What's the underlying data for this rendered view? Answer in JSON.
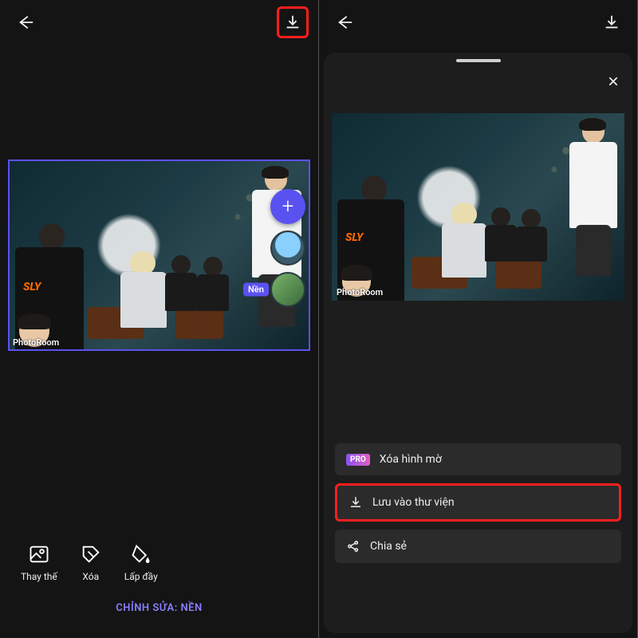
{
  "left": {
    "watermark": "PhotoRoom",
    "layer_tag": "Nền",
    "toolbar": {
      "replace": "Thay thế",
      "delete": "Xóa",
      "fill": "Lấp đầy"
    },
    "editing_label": "CHỈNH SỬA: NỀN"
  },
  "right": {
    "watermark": "PhotoRoom",
    "menu": {
      "pro_badge": "PRO",
      "remove_watermark": "Xóa hình mờ",
      "save_to_gallery": "Lưu vào thư viện",
      "share": "Chia sẻ"
    }
  }
}
